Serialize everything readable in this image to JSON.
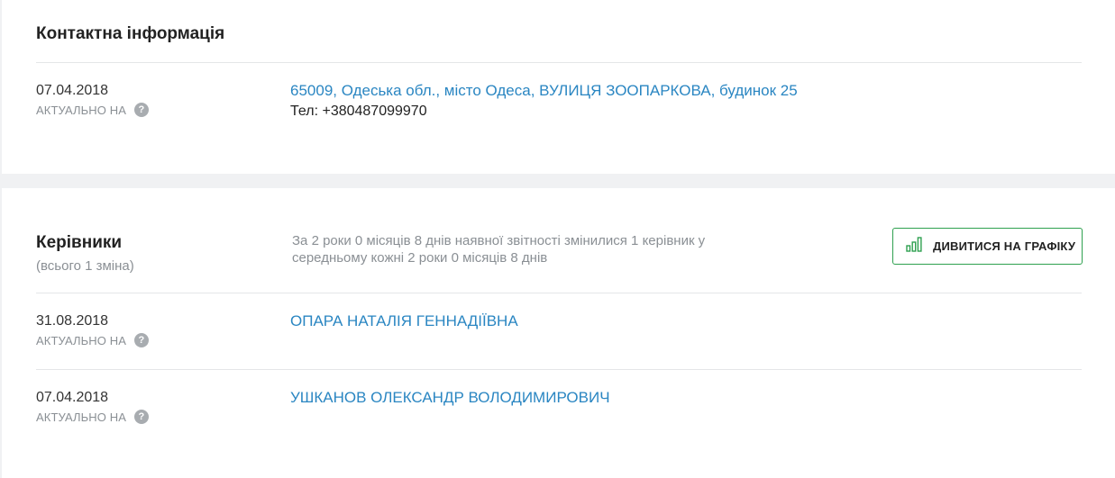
{
  "contacts": {
    "title": "Контактна інформація",
    "record": {
      "date": "07.04.2018",
      "actual_label": "АКТУАЛЬНО НА",
      "help_glyph": "?",
      "address": "65009, Одеська обл., місто Одеса, ВУЛИЦЯ ЗООПАРКОВА, будинок 25",
      "phone": "Тел: +380487099970"
    }
  },
  "managers": {
    "title": "Керівники",
    "subtitle": "(всього 1 зміна)",
    "summary_line1": "За 2 роки 0 місяців 8 днів наявної звітності змінилися 1 керівник у",
    "summary_line2": "середньому кожні 2 роки 0 місяців 8 днів",
    "chart_button_label": "ДИВИТИСЯ НА ГРАФІКУ",
    "chart_button_icon": "bar-chart-icon",
    "accent_color": "#2ea04f",
    "items": [
      {
        "date": "31.08.2018",
        "actual_label": "АКТУАЛЬНО НА",
        "help_glyph": "?",
        "name": "ОПАРА НАТАЛІЯ ГЕННАДІЇВНА"
      },
      {
        "date": "07.04.2018",
        "actual_label": "АКТУАЛЬНО НА",
        "help_glyph": "?",
        "name": "УШКАНОВ ОЛЕКСАНДР ВОЛОДИМИРОВИЧ"
      }
    ]
  },
  "link_color": "#2a86c2"
}
